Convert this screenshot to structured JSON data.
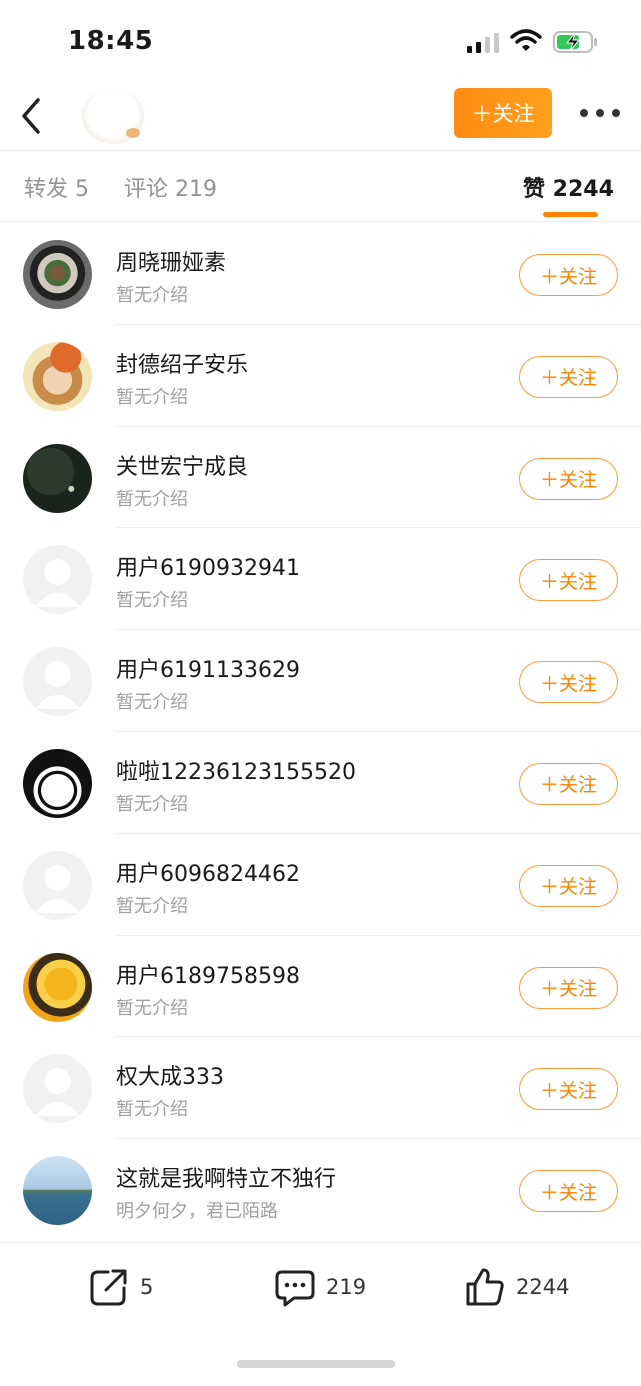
{
  "status_bar": {
    "time": "18:45"
  },
  "header": {
    "follow_label": "＋关注"
  },
  "tabs": {
    "repost": "转发 5",
    "comment": "评论 219",
    "like": "赞 2244"
  },
  "users": [
    {
      "name": "周晓珊娅素",
      "bio": "暂无介绍",
      "avatar": "food-photo"
    },
    {
      "name": "封德绍子安乐",
      "bio": "暂无介绍",
      "avatar": "girl-orange-hat-photo"
    },
    {
      "name": "关世宏宁成良",
      "bio": "暂无介绍",
      "avatar": "dark-forest-photo"
    },
    {
      "name": "用户6190932941",
      "bio": "暂无介绍",
      "avatar": "default-avatar"
    },
    {
      "name": "用户6191133629",
      "bio": "暂无介绍",
      "avatar": "default-avatar"
    },
    {
      "name": "啦啦12236123155520",
      "bio": "暂无介绍",
      "avatar": "cartoon-face"
    },
    {
      "name": "用户6096824462",
      "bio": "暂无介绍",
      "avatar": "default-avatar"
    },
    {
      "name": "用户6189758598",
      "bio": "暂无介绍",
      "avatar": "mango-pudding-photo"
    },
    {
      "name": "权大成333",
      "bio": "暂无介绍",
      "avatar": "default-avatar"
    },
    {
      "name": "这就是我啊特立不独行",
      "bio": "明夕何夕，君已陌路",
      "avatar": "lake-photo"
    }
  ],
  "follow_button_label": "＋关注",
  "bottom_bar": {
    "repost_count": "5",
    "comment_count": "219",
    "like_count": "2244"
  },
  "colors": {
    "accent": "#ff8200",
    "muted": "#a0a0a0"
  }
}
